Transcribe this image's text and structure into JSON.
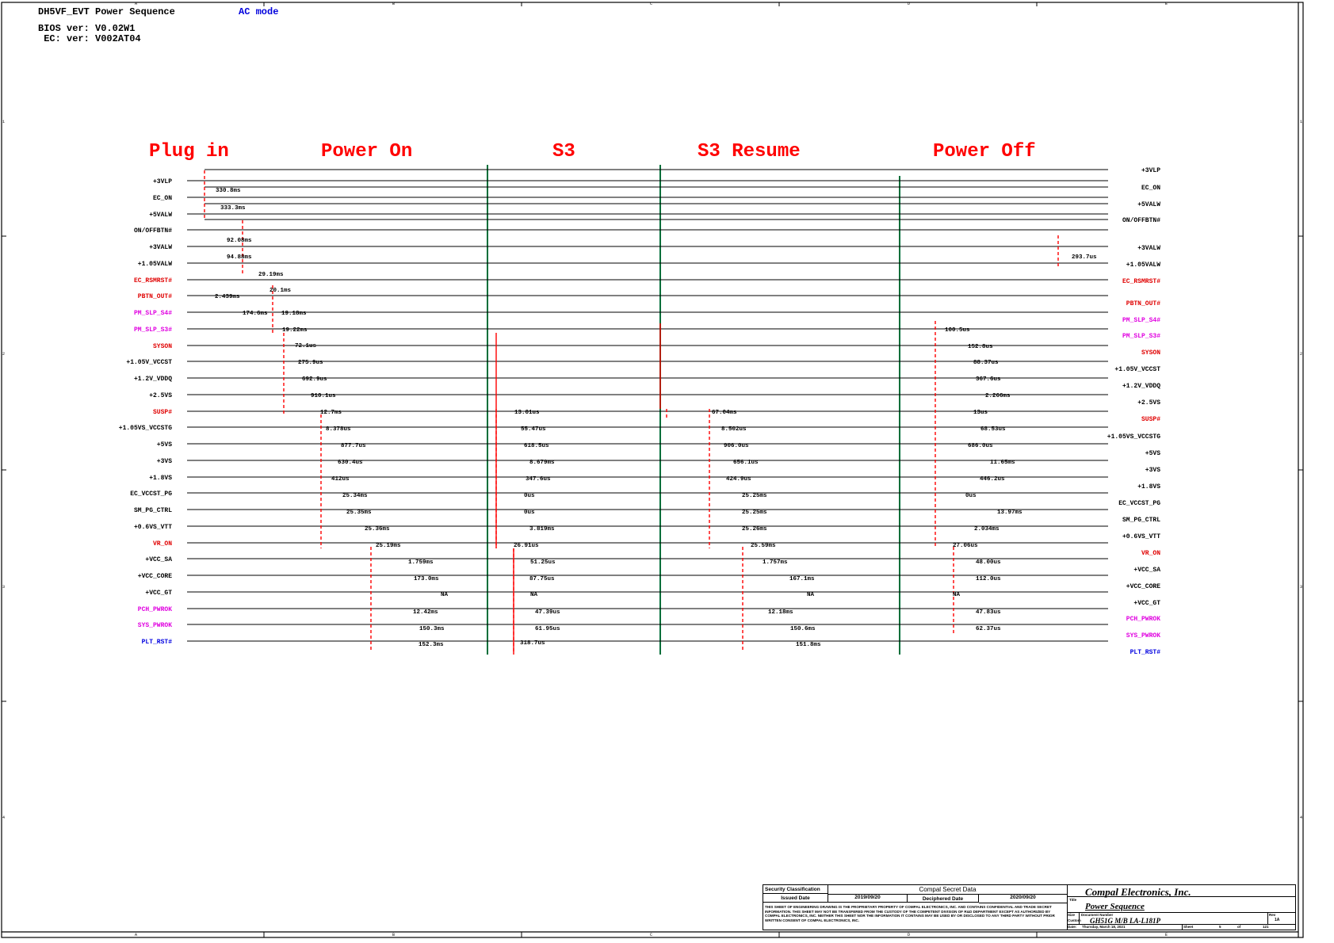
{
  "header": {
    "title": "DH5VF_EVT Power Sequence",
    "mode": "AC mode",
    "bios": "BIOS ver: V0.02W1",
    "ec": " EC: ver: V002AT04"
  },
  "phases": [
    "Plug in",
    "Power On",
    "S3",
    "S3 Resume",
    "Power Off"
  ],
  "left_signals": [
    {
      "name": "+3VLP",
      "color": "#000"
    },
    {
      "name": "EC_ON",
      "color": "#000"
    },
    {
      "name": "+5VALW",
      "color": "#000"
    },
    {
      "name": "ON/OFFBTN#",
      "color": "#000"
    },
    {
      "name": "+3VALW",
      "color": "#000"
    },
    {
      "name": "+1.05VALW",
      "color": "#000"
    },
    {
      "name": "EC_RSMRST#",
      "color": "#e00000"
    },
    {
      "name": "PBTN_OUT#",
      "color": "#e00000"
    },
    {
      "name": "PM_SLP_S4#",
      "color": "#e000e0"
    },
    {
      "name": "PM_SLP_S3#",
      "color": "#e000e0"
    },
    {
      "name": "SYSON",
      "color": "#e00000"
    },
    {
      "name": "+1.05V_VCCST",
      "color": "#000"
    },
    {
      "name": "+1.2V_VDDQ",
      "color": "#000"
    },
    {
      "name": "+2.5VS",
      "color": "#000"
    },
    {
      "name": "SUSP#",
      "color": "#e00000"
    },
    {
      "name": "+1.05VS_VCCSTG",
      "color": "#000"
    },
    {
      "name": "+5VS",
      "color": "#000"
    },
    {
      "name": "+3VS",
      "color": "#000"
    },
    {
      "name": "+1.8VS",
      "color": "#000"
    },
    {
      "name": "EC_VCCST_PG",
      "color": "#000"
    },
    {
      "name": "SM_PG_CTRL",
      "color": "#000"
    },
    {
      "name": "+0.6VS_VTT",
      "color": "#000"
    },
    {
      "name": "VR_ON",
      "color": "#e00000"
    },
    {
      "name": "+VCC_SA",
      "color": "#000"
    },
    {
      "name": "+VCC_CORE",
      "color": "#000"
    },
    {
      "name": "+VCC_GT",
      "color": "#000"
    },
    {
      "name": "PCH_PWROK",
      "color": "#e000e0"
    },
    {
      "name": "SYS_PWROK",
      "color": "#e000e0"
    },
    {
      "name": "PLT_RST#",
      "color": "#0000e0"
    }
  ],
  "right_signals": [
    {
      "name": "+3VLP",
      "color": "#000"
    },
    {
      "name": "EC_ON",
      "color": "#000"
    },
    {
      "name": "+5VALW",
      "color": "#000"
    },
    {
      "name": "ON/OFFBTN#",
      "color": "#000"
    },
    {
      "name": "+3VALW",
      "color": "#000"
    },
    {
      "name": "+1.05VALW",
      "color": "#000"
    },
    {
      "name": "EC_RSMRST#",
      "color": "#e00000"
    },
    {
      "name": "PBTN_OUT#",
      "color": "#e00000"
    },
    {
      "name": "PM_SLP_S4#",
      "color": "#e000e0"
    },
    {
      "name": "PM_SLP_S3#",
      "color": "#e000e0"
    },
    {
      "name": "SYSON",
      "color": "#e00000"
    },
    {
      "name": "+1.05V_VCCST",
      "color": "#000"
    },
    {
      "name": "+1.2V_VDDQ",
      "color": "#000"
    },
    {
      "name": "+2.5VS",
      "color": "#000"
    },
    {
      "name": "SUSP#",
      "color": "#e00000"
    },
    {
      "name": "+1.05VS_VCCSTG",
      "color": "#000"
    },
    {
      "name": "+5VS",
      "color": "#000"
    },
    {
      "name": "+3VS",
      "color": "#000"
    },
    {
      "name": "+1.8VS",
      "color": "#000"
    },
    {
      "name": "EC_VCCST_PG",
      "color": "#000"
    },
    {
      "name": "SM_PG_CTRL",
      "color": "#000"
    },
    {
      "name": "+0.6VS_VTT",
      "color": "#000"
    },
    {
      "name": "VR_ON",
      "color": "#e00000"
    },
    {
      "name": "+VCC_SA",
      "color": "#000"
    },
    {
      "name": "+VCC_CORE",
      "color": "#000"
    },
    {
      "name": "+VCC_GT",
      "color": "#000"
    },
    {
      "name": "PCH_PWROK",
      "color": "#e000e0"
    },
    {
      "name": "SYS_PWROK",
      "color": "#e000e0"
    },
    {
      "name": "PLT_RST#",
      "color": "#0000e0"
    }
  ],
  "timing_labels": {
    "plugin": [
      "330.8ms",
      "333.3ms"
    ],
    "poweron_early": [
      "92.08ms",
      "94.88ms",
      "29.19ms",
      "2.439ms",
      "20.1ms",
      "174.6ms",
      "19.18ms",
      "19.22ms",
      "72.1us",
      "275.9us",
      "692.9us",
      "910.1us"
    ],
    "poweron": [
      "12.7ms",
      "8.378us",
      "877.7us",
      "630.4us",
      "412us",
      "25.34ms",
      "25.35ms",
      "25.36ms",
      "25.19ms",
      "1.759ms",
      "173.0ms",
      "NA",
      "12.42ms",
      "150.3ms",
      "152.3ms"
    ],
    "s3": [
      "13.01us",
      "55.47us",
      "618.5us",
      "8.679ms",
      "347.6us",
      "0us",
      "0us",
      "3.819ms",
      "26.91us",
      "51.25us",
      "87.75us",
      "NA",
      "47.39us",
      "61.95us",
      "318.7us"
    ],
    "s3resume": [
      "67.04ms",
      "8.502us",
      "906.0us",
      "656.1us",
      "424.9us",
      "25.25ms",
      "25.25ms",
      "25.26ms",
      "25.59ms",
      "1.757ms",
      "167.1ms",
      "NA",
      "12.18ms",
      "150.6ms",
      "151.8ms"
    ],
    "poweroff": [
      "293.7us",
      "100.5us",
      "152.8us",
      "88.37us",
      "367.6us",
      "2.266ms",
      "13us",
      "68.53us",
      "686.0us",
      "11.65ms",
      "446.2us",
      "0us",
      "13.97ms",
      "2.034ms",
      "27.06us",
      "48.00us",
      "112.0us",
      "NA",
      "47.83us",
      "62.37us"
    ]
  },
  "border": {
    "col_letters": [
      "A",
      "B",
      "C",
      "D",
      "E"
    ],
    "row_numbers": [
      "1",
      "2",
      "3",
      "4"
    ]
  },
  "title_block": {
    "security_label": "Security Classification",
    "security_value": "Compal Secret Data",
    "issued_label": "Issued Date",
    "issued_value": "2019/09/20",
    "deciphered_label": "Deciphered Date",
    "deciphered_value": "2020/09/20",
    "company": "Compal Electronics, Inc.",
    "title_label": "Title",
    "title_value": "Power Sequence",
    "notice": "THIS SHEET OF ENGINEERING DRAWING IS THE PROPRIETARY PROPERTY OF COMPAL ELECTRONICS, INC. AND CONTAINS CONFIDENTIAL AND TRADE SECRET INFORMATION. THIS SHEET MAY NOT BE TRANSFERED FROM THE CUSTODY OF THE COMPETENT DIVISION OF R&D DEPARTMENT EXCEPT AS AUTHORIZED BY COMPAL ELECTRONICS, INC. NEITHER THIS SHEET NOR THE INFORMATION IT CONTAINS MAY BE USED BY OR DISCLOSED TO ANY THIRD PARTY WITHOUT PRIOR WRITTEN CONSENT OF COMPAL ELECTRONICS, INC.",
    "size_label": "Size",
    "size_value": "Custom",
    "docnum_label": "Document Number",
    "docnum_value": "GH51G M/B LA-L181P",
    "rev_label": "Rev",
    "rev_value": "1A",
    "date_label": "Date:",
    "date_value": "Thursday, March 18, 2021",
    "sheet_label": "Sheet",
    "sheet_value": "5",
    "of_label": "of",
    "of_value": "121"
  }
}
